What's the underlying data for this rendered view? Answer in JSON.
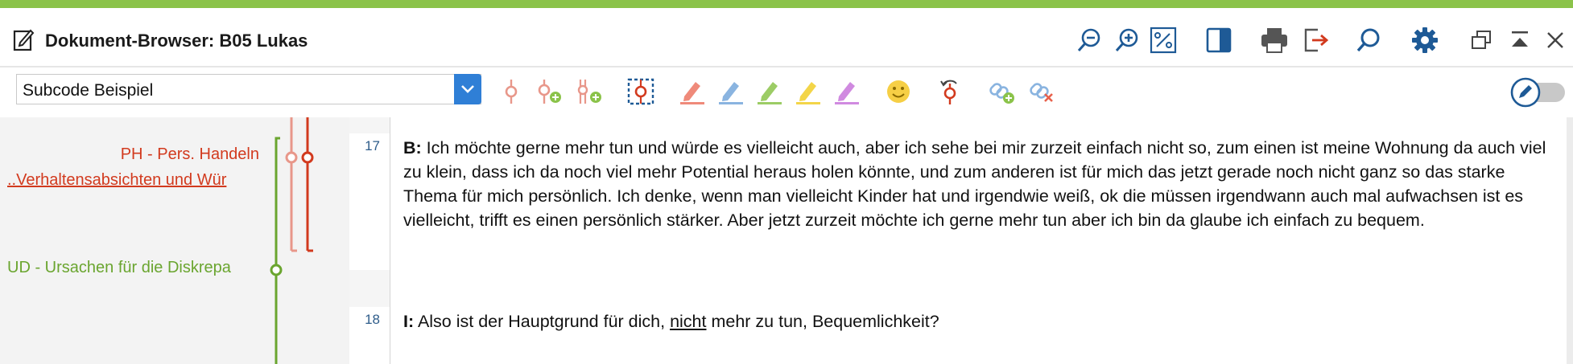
{
  "colors": {
    "accent_green": "#8bc34a",
    "icon_blue": "#1e5a96",
    "code_red": "#d23a1e",
    "code_pink": "#e8978a",
    "code_green": "#6aa52f"
  },
  "window": {
    "title": "Dokument-Browser: B05 Lukas",
    "title_icon": "edit-document-icon",
    "toolbar_icons": [
      "zoom-out-icon",
      "zoom-in-icon",
      "zoom-100-icon",
      "panel-toggle-icon",
      "print-icon",
      "export-icon",
      "search-icon",
      "settings-gear-icon",
      "undock-window-icon",
      "minimize-icon",
      "close-icon"
    ]
  },
  "coding_toolbar": {
    "code_selector": {
      "value": "Subcode Beispiel"
    },
    "icons": [
      "code-icon",
      "code-add-icon",
      "code-add-subcode-icon",
      "code-selection-icon",
      "highlight-red-icon",
      "highlight-blue-icon",
      "highlight-green-icon",
      "highlight-yellow-icon",
      "highlight-purple-icon",
      "emoticon-icon",
      "undo-code-icon",
      "link-add-icon",
      "link-remove-icon"
    ],
    "edit_mode_toggle": "edit-pencil-icon"
  },
  "codes": [
    {
      "label": "PH - Pers. Handeln",
      "color": "#d23a1e"
    },
    {
      "label": "..Verhaltensabsichten und Wür",
      "color": "#d23a1e"
    },
    {
      "label": "UD - Ursachen für die Diskrepa",
      "color": "#6aa52f"
    }
  ],
  "paragraphs": [
    {
      "number": "17",
      "speaker": "B:",
      "text": "Ich möchte gerne mehr tun und würde es vielleicht auch, aber ich sehe bei mir zurzeit einfach nicht so, zum einen ist meine Wohnung da auch viel zu klein, dass ich da noch viel mehr Potential heraus holen könnte, und zum anderen ist für mich das jetzt gerade noch nicht ganz so das starke Thema für mich persönlich. Ich denke, wenn man vielleicht Kinder hat und irgendwie weiß, ok die müssen irgendwann auch mal aufwachsen ist es vielleicht, trifft es einen persönlich stärker. Aber jetzt zurzeit möchte ich gerne mehr tun aber ich bin da glaube ich einfach zu bequem."
    },
    {
      "number": "18",
      "speaker": "I:",
      "text_before": "Also ist der Hauptgrund für dich,",
      "text_underlined": "nicht",
      "text_after": "mehr zu tun, Bequemlichkeit?"
    }
  ]
}
